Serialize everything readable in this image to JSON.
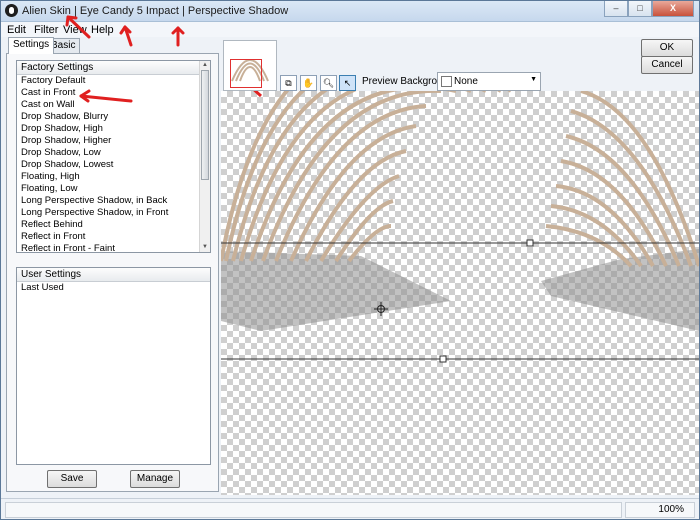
{
  "window": {
    "title": "Alien Skin | Eye Candy 5 Impact | Perspective Shadow",
    "controls": [
      "–",
      "□",
      "X"
    ]
  },
  "menu": [
    "Edit",
    "Filter",
    "View",
    "Help"
  ],
  "tabs": [
    "Settings",
    "Basic"
  ],
  "factory_settings": {
    "header": "Factory Settings",
    "items": [
      "Factory Default",
      "Cast in Front",
      "Cast on Wall",
      "Drop Shadow, Blurry",
      "Drop Shadow, High",
      "Drop Shadow, Higher",
      "Drop Shadow, Low",
      "Drop Shadow, Lowest",
      "Floating, High",
      "Floating, Low",
      "Long Perspective Shadow, in Back",
      "Long Perspective Shadow, in Front",
      "Reflect Behind",
      "Reflect in Front",
      "Reflect in Front - Faint"
    ]
  },
  "user_settings": {
    "header": "User Settings",
    "items": [
      "Last Used"
    ]
  },
  "buttons": {
    "save": "Save",
    "manage": "Manage",
    "ok": "OK",
    "cancel": "Cancel"
  },
  "preview": {
    "background_label": "Preview Background:",
    "background_value": "None"
  },
  "status": {
    "zoom": "100%"
  },
  "colors": {
    "annotation_arrow": "#e02020",
    "thumbnail_frame": "#e03030",
    "shape_fill": "#c8b098"
  },
  "icons": [
    "app-icon",
    "hand-tool-icon",
    "zoom-tool-icon",
    "pointer-tool-icon",
    "compare-icon",
    "move-handle-icon",
    "dropdown-arrow-icon"
  ]
}
